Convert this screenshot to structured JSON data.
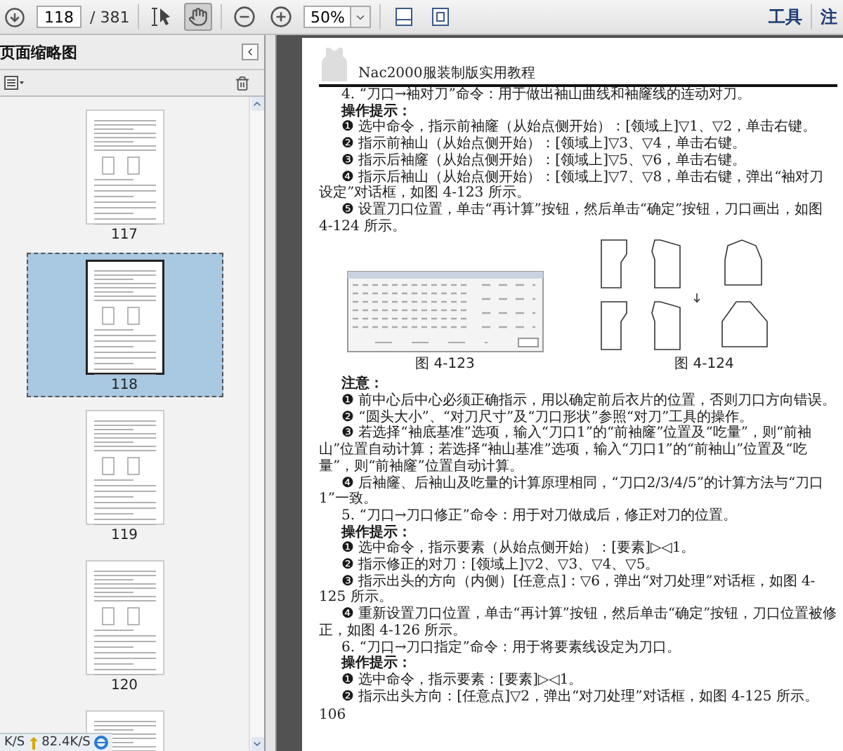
{
  "toolbar": {
    "page_field": "118",
    "page_total": "/ 381",
    "tools": [
      {
        "kind": "select",
        "selected": false
      },
      {
        "kind": "hand",
        "selected": true
      }
    ],
    "zoom_field": "50%",
    "links": [
      "工具",
      "注"
    ]
  },
  "sidebar": {
    "title": "页面缩略图",
    "thumbnails": [
      {
        "label": "117",
        "selected": false
      },
      {
        "label": "118",
        "selected": true
      },
      {
        "label": "119",
        "selected": false
      },
      {
        "label": "120",
        "selected": false
      },
      {
        "selected": false
      }
    ]
  },
  "speed_overlay": {
    "download": "K/S",
    "upload": "82.4K/S"
  },
  "document": {
    "header": "Nac2000服装制版实用教程",
    "blocks": [
      {
        "kind": "command",
        "text": "4. “刀口→袖对刀”命令：用于做出袖山曲线和袖窿线的连动对刀。"
      },
      {
        "kind": "label",
        "text": "操作提示："
      },
      {
        "kind": "step",
        "text": "❶ 选中命令，指示前袖窿（从始点侧开始）：[领域上]▽1、▽2，单击右键。"
      },
      {
        "kind": "step",
        "text": "❷ 指示前袖山（从始点侧开始）：[领域上]▽3、▽4，单击右键。"
      },
      {
        "kind": "step",
        "text": "❸ 指示后袖窿（从始点侧开始）：[领域上]▽5、▽6，单击右键。"
      },
      {
        "kind": "step",
        "text": "❹ 指示后袖山（从始点侧开始）：[领域上]▽7、▽8，单击右键，弹出“袖对刀设定”对话框，如图 4-123 所示。"
      },
      {
        "kind": "step",
        "text": "❺ 设置刀口位置，单击“再计算”按钮，然后单击“确定”按钮，刀口画出，如图 4-124 所示。"
      },
      {
        "kind": "figures",
        "captions": [
          "图 4-123",
          "图 4-124"
        ]
      },
      {
        "kind": "label",
        "text": "注意："
      },
      {
        "kind": "step",
        "text": "❶ 前中心后中心必须正确指示，用以确定前后衣片的位置，否则刀口方向错误。"
      },
      {
        "kind": "step",
        "text": "❷ “圆头大小”、“对刀尺寸”及“刀口形状”参照“对刀”工具的操作。"
      },
      {
        "kind": "step",
        "text": "❸ 若选择“袖底基准”选项，输入“刀口1”的“前袖窿”位置及“吃量”，则“前袖山”位置自动计算；若选择“袖山基准”选项，输入“刀口1”的“前袖山”位置及“吃量”，则“前袖窿”位置自动计算。"
      },
      {
        "kind": "step",
        "text": "❹ 后袖窿、后袖山及吃量的计算原理相同，“刀口2/3/4/5”的计算方法与“刀口1”一致。"
      },
      {
        "kind": "command",
        "text": "5. “刀口→刀口修正”命令：用于对刀做成后，修正对刀的位置。"
      },
      {
        "kind": "label",
        "text": "操作提示："
      },
      {
        "kind": "step",
        "text": "❶ 选中命令，指示要素（从始点侧开始）：[要素]▷◁1。"
      },
      {
        "kind": "step",
        "text": "❷ 指示修正的对刀：[领域上]▽2、▽3、▽4、▽5。"
      },
      {
        "kind": "step",
        "text": "❸ 指示出头的方向（内侧）[任意点]：▽6，弹出“对刀处理”对话框，如图 4-125 所示。"
      },
      {
        "kind": "step",
        "text": "❹ 重新设置刀口位置，单击“再计算”按钮，然后单击“确定”按钮，刀口位置被修正，如图 4-126 所示。"
      },
      {
        "kind": "command",
        "text": "6. “刀口→刀口指定”命令：用于将要素线设定为刀口。"
      },
      {
        "kind": "label",
        "text": "操作提示："
      },
      {
        "kind": "step",
        "text": "❶ 选中命令，指示要素：[要素]▷◁1。"
      },
      {
        "kind": "step",
        "text": "❷ 指示出头方向：[任意点]▽2，弹出“对刀处理”对话框，如图 4-125 所示。"
      }
    ],
    "page_number": "106"
  }
}
